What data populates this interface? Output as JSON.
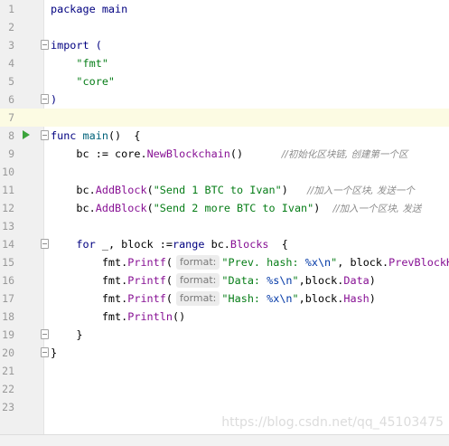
{
  "editor": {
    "lines": [
      {
        "n": "1"
      },
      {
        "n": "2"
      },
      {
        "n": "3"
      },
      {
        "n": "4"
      },
      {
        "n": "5"
      },
      {
        "n": "6"
      },
      {
        "n": "7"
      },
      {
        "n": "8"
      },
      {
        "n": "9"
      },
      {
        "n": "10"
      },
      {
        "n": "11"
      },
      {
        "n": "12"
      },
      {
        "n": "13"
      },
      {
        "n": "14"
      },
      {
        "n": "15"
      },
      {
        "n": "16"
      },
      {
        "n": "17"
      },
      {
        "n": "18"
      },
      {
        "n": "19"
      },
      {
        "n": "20"
      },
      {
        "n": "21"
      },
      {
        "n": "22"
      },
      {
        "n": "23"
      }
    ],
    "code": {
      "l1": {
        "kw": "package",
        "name": "main"
      },
      "l3": {
        "kw": "import",
        "paren": "("
      },
      "l4": {
        "str": "\"fmt\""
      },
      "l5": {
        "str": "\"core\""
      },
      "l6": {
        "paren": ")"
      },
      "l8": {
        "kw": "func",
        "name": "main",
        "rest": "()  {"
      },
      "l9": {
        "lhs": "bc := ",
        "pkg": "core",
        "dot": ".",
        "call": "NewBlockchain",
        "rest": "()",
        "comment": "//初始化区块链, 创建第一个区"
      },
      "l11": {
        "recv": "bc",
        "dot": ".",
        "call": "AddBlock",
        "open": "(",
        "str": "\"Send 1 BTC to Ivan\"",
        "close": ")",
        "comment": "//加入一个区块, 发送一个"
      },
      "l12": {
        "recv": "bc",
        "dot": ".",
        "call": "AddBlock",
        "open": "(",
        "str": "\"Send 2 more BTC to Ivan\"",
        "close": ")",
        "comment": "//加入一个区块, 发送"
      },
      "l14": {
        "kw": "for",
        "mid": " _, block :=",
        "kw2": "range",
        "recv": " bc",
        "dot": ".",
        "field": "Blocks",
        "rest": "  {"
      },
      "l15": {
        "pkg": "fmt",
        "dot": ".",
        "call": "Printf",
        "open": "(",
        "hint": "format:",
        "str1": "\"Prev. hash: ",
        "esc": "%x\\n",
        "str2": "\"",
        "rest": ", block.",
        "field": "PrevBlockH"
      },
      "l16": {
        "pkg": "fmt",
        "dot": ".",
        "call": "Printf",
        "open": "(",
        "hint": "format:",
        "str1": "\"Data: ",
        "esc": "%s\\n",
        "str2": "\"",
        "rest": ",block.",
        "field": "Data",
        "close": ")"
      },
      "l17": {
        "pkg": "fmt",
        "dot": ".",
        "call": "Printf",
        "open": "(",
        "hint": "format:",
        "str1": "\"Hash: ",
        "esc": "%x\\n",
        "str2": "\"",
        "rest": ",block.",
        "field": "Hash",
        "close": ")"
      },
      "l18": {
        "pkg": "fmt",
        "dot": ".",
        "call": "Println",
        "rest": "()"
      },
      "l19": {
        "brace": "}"
      },
      "l20": {
        "brace": "}"
      }
    }
  },
  "watermark": "https://blog.csdn.net/qq_45103475",
  "colors": {
    "gutter": "#f0f0f0",
    "current_line": "#fcfbe3",
    "keyword": "#000080",
    "string": "#067d17",
    "method": "#871094",
    "comment": "#8c8c8c",
    "run_icon": "#3ba43b"
  }
}
